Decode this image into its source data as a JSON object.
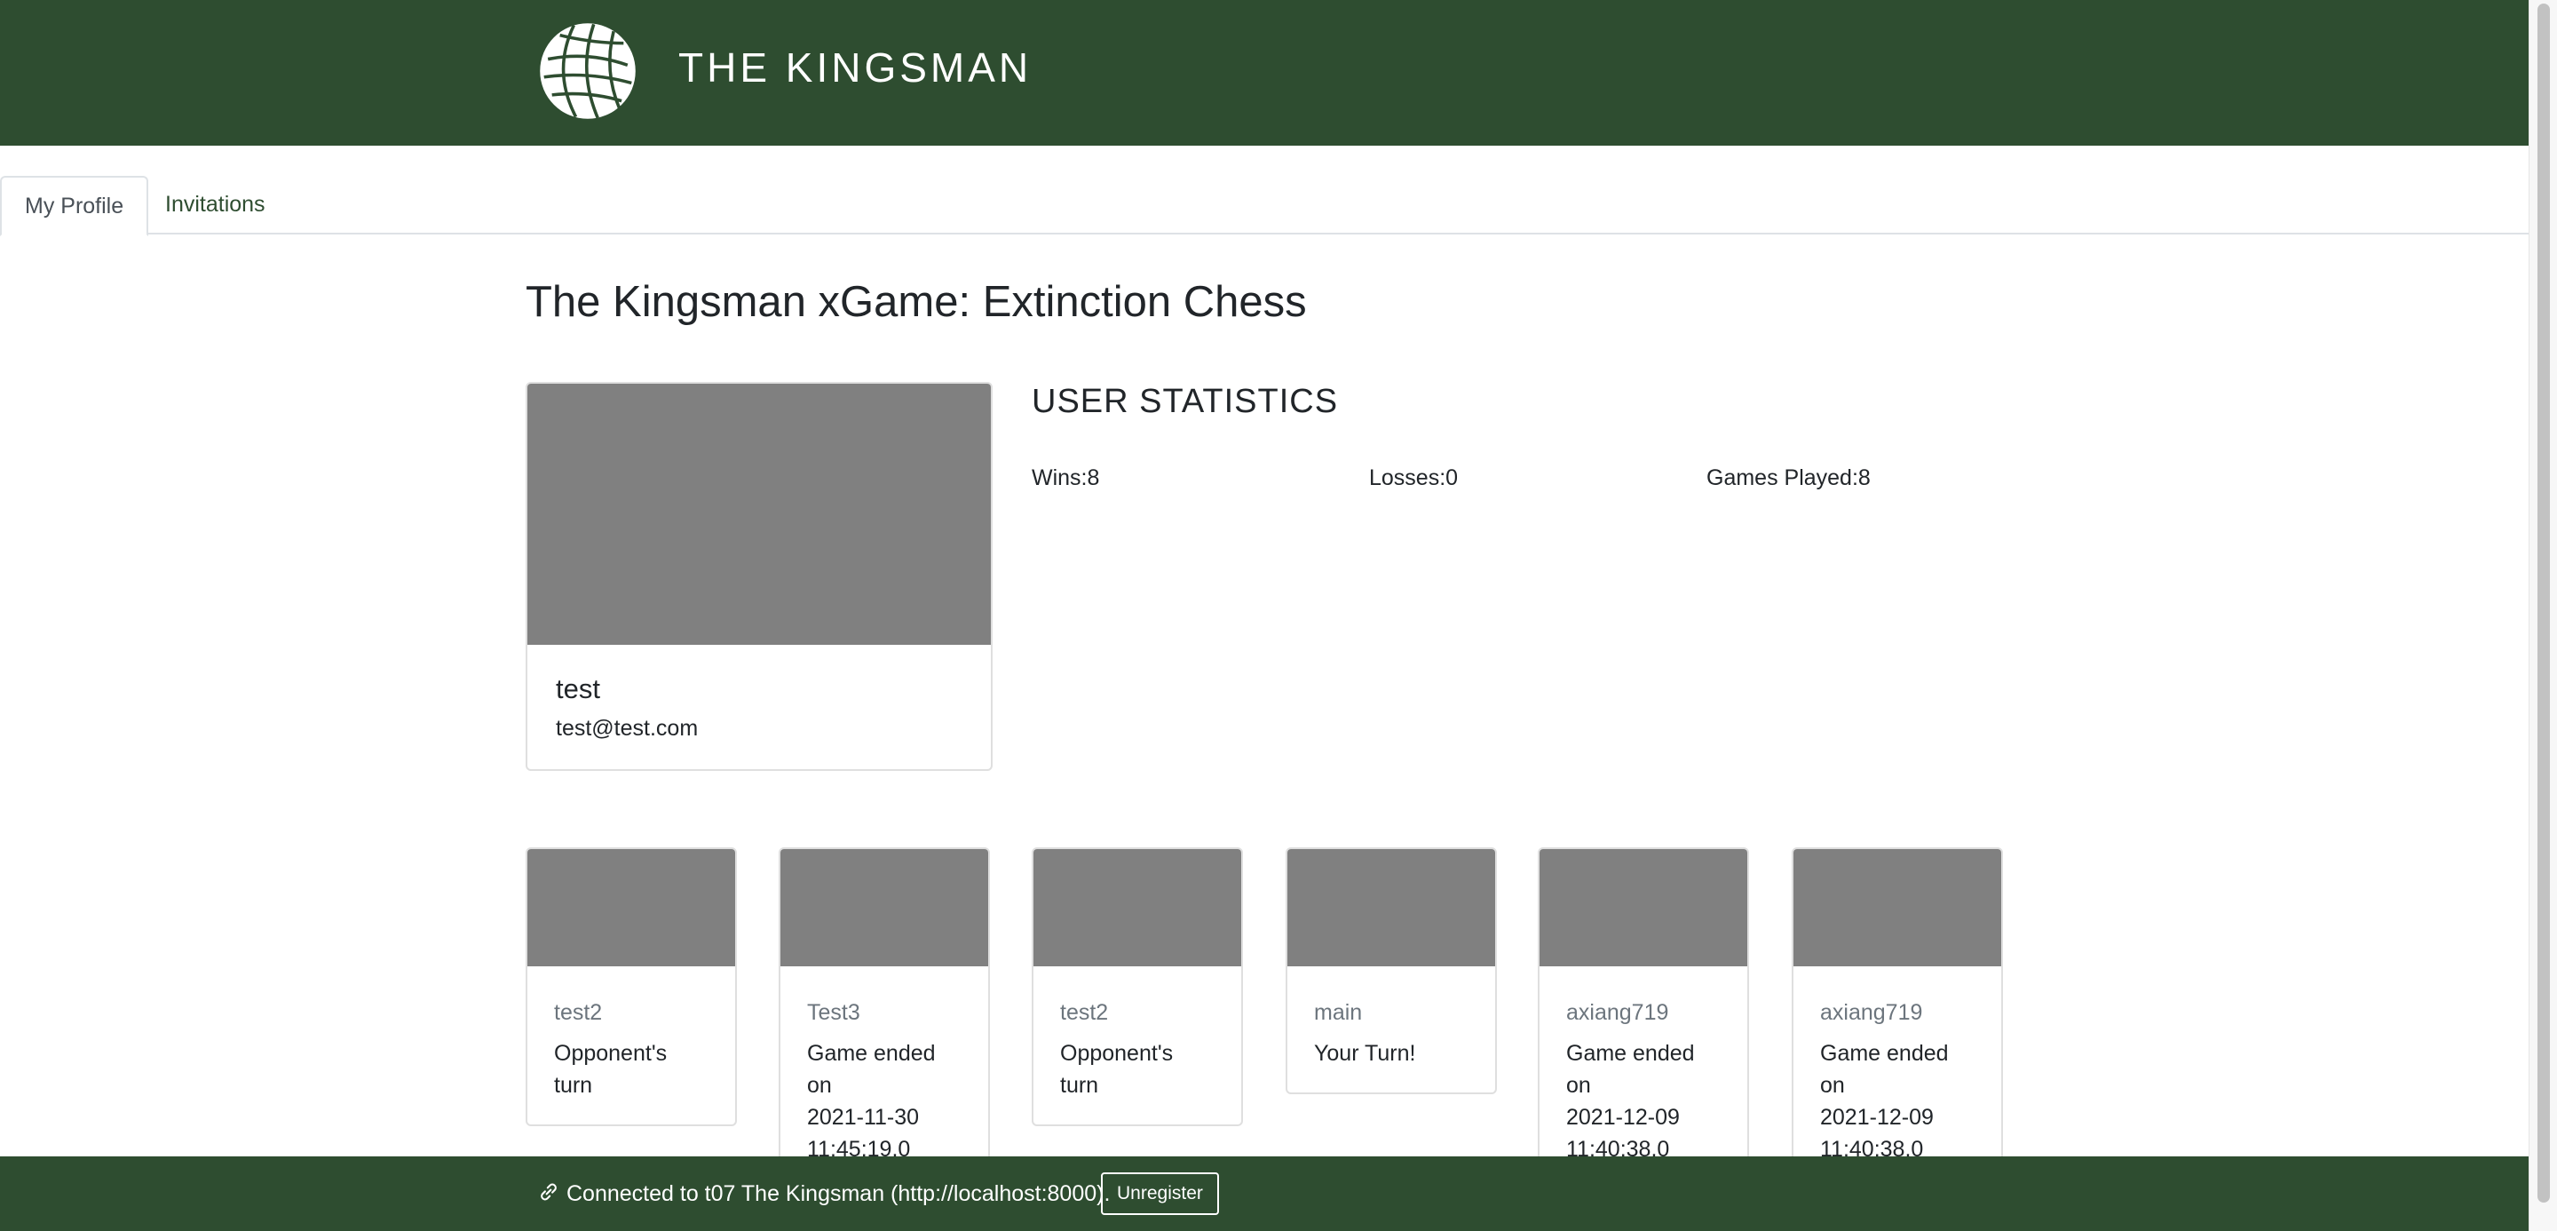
{
  "header": {
    "brand": "THE KINGSMAN",
    "logo_icon": "globe-icon",
    "bg_color": "#2e4d30"
  },
  "tabs": [
    {
      "label": "My Profile",
      "active": true
    },
    {
      "label": "Invitations",
      "active": false
    }
  ],
  "main": {
    "title": "The Kingsman xGame: Extinction Chess"
  },
  "profile": {
    "name": "test",
    "email": "test@test.com"
  },
  "stats": {
    "title": "USER STATISTICS",
    "wins": "Wins:8",
    "losses": "Losses:0",
    "games_played": "Games Played:8"
  },
  "games": [
    {
      "opponent": "test2",
      "status_lines": [
        "Opponent's",
        "turn"
      ]
    },
    {
      "opponent": "Test3",
      "status_lines": [
        "Game ended on",
        "2021-11-30",
        "11:45:19.0"
      ]
    },
    {
      "opponent": "test2",
      "status_lines": [
        "Opponent's",
        "turn"
      ]
    },
    {
      "opponent": "main",
      "status_lines": [
        "Your Turn!"
      ]
    },
    {
      "opponent": "axiang719",
      "status_lines": [
        "Game ended on",
        "2021-12-09",
        "11:40:38.0"
      ]
    },
    {
      "opponent": "axiang719",
      "status_lines": [
        "Game ended on",
        "2021-12-09",
        "11:40:38.0"
      ]
    }
  ],
  "footer": {
    "icon": "link-icon",
    "text": "Connected to t07 The Kingsman  (http://localhost:8000).",
    "unregister_label": "Unregister"
  }
}
